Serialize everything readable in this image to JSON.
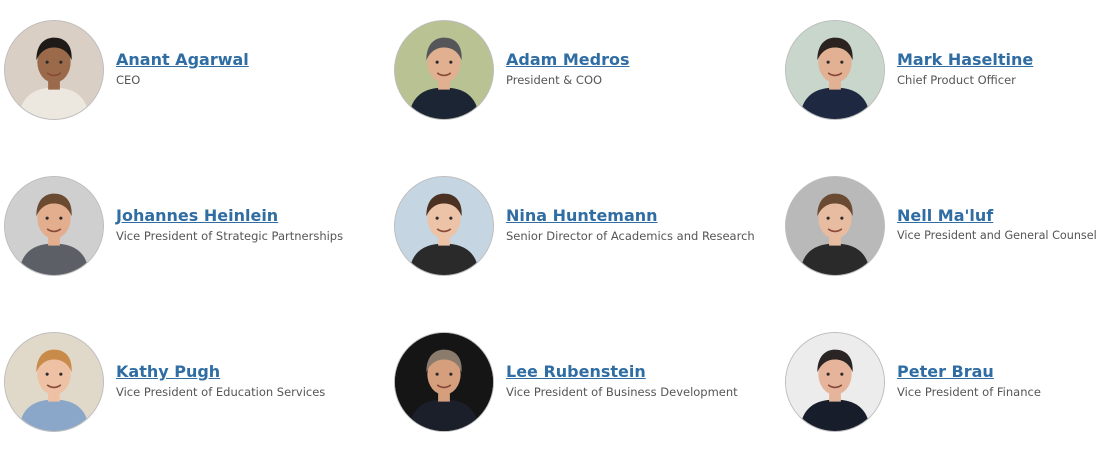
{
  "team": [
    {
      "name": "Anant Agarwal",
      "title": "CEO",
      "photo_bg": "#d9cfc4",
      "skin": "#9a6a4a",
      "hair": "#1e1a18",
      "shirt": "#ece7df"
    },
    {
      "name": "Adam Medros",
      "title": "President & COO",
      "photo_bg": "#b8c293",
      "skin": "#e0b090",
      "hair": "#55565a",
      "shirt": "#1c2533"
    },
    {
      "name": "Mark Haseltine",
      "title": "Chief Product Officer",
      "photo_bg": "#c8d6cc",
      "skin": "#e2b092",
      "hair": "#2a2320",
      "shirt": "#1e2841"
    },
    {
      "name": "Johannes Heinlein",
      "title": "Vice President of Strategic Partnerships",
      "photo_bg": "#cfcfcf",
      "skin": "#e2ae8e",
      "hair": "#6a4a30",
      "shirt": "#5c5f66"
    },
    {
      "name": "Nina Huntemann",
      "title": "Senior Director of Academics and Research",
      "photo_bg": "#c6d5e2",
      "skin": "#edc3a8",
      "hair": "#4a3122",
      "shirt": "#2a2a2a"
    },
    {
      "name": "Nell Ma'luf",
      "title": "Vice President and General Counsel",
      "photo_bg": "#b9b9b9",
      "skin": "#e8bca0",
      "hair": "#6a4a33",
      "shirt": "#2a2a2a"
    },
    {
      "name": "Kathy Pugh",
      "title": "Vice President of Education Services",
      "photo_bg": "#e0d8c8",
      "skin": "#eec1a4",
      "hair": "#c98b4a",
      "shirt": "#8aa6c9"
    },
    {
      "name": "Lee Rubenstein",
      "title": "Vice President of Business Development",
      "photo_bg": "#151515",
      "skin": "#d59e7c",
      "hair": "#8b7b6c",
      "shirt": "#1b1f2a"
    },
    {
      "name": "Peter Brau",
      "title": "Vice President of Finance",
      "photo_bg": "#ececec",
      "skin": "#e5b49a",
      "hair": "#2a2424",
      "shirt": "#181d2b"
    }
  ]
}
